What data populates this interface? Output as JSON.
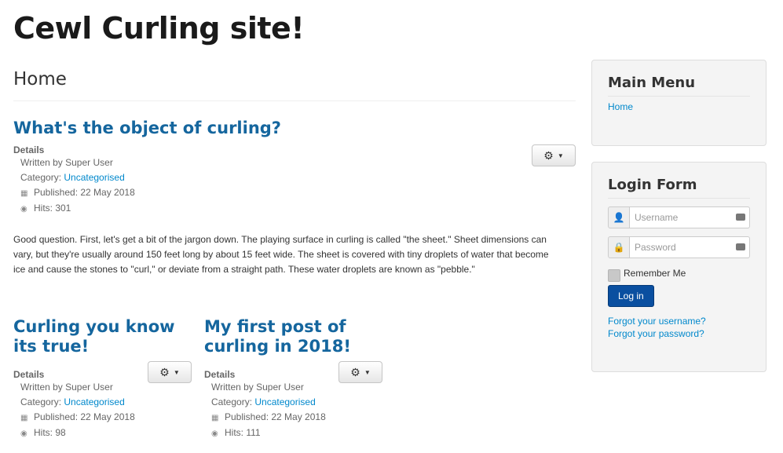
{
  "site_title": "Cewl Curling site!",
  "page_heading": "Home",
  "lead_article": {
    "title": "What's the object of curling?",
    "details_label": "Details",
    "author": "Written by Super User",
    "category_label": "Category: ",
    "category": "Uncategorised",
    "published": "Published: 22 May 2018",
    "hits": "Hits: 301",
    "body": "Good question. First, let's get a bit of the jargon down. The playing surface in curling is called \"the sheet.\" Sheet dimensions can vary, but they're usually around 150 feet long by about 15 feet wide. The sheet is covered with tiny droplets of water that become ice and cause the stones to \"curl,\" or deviate from a straight path. These water droplets are known as \"pebble.\""
  },
  "articles": [
    {
      "title": "Curling you know its true!",
      "details_label": "Details",
      "author": "Written by Super User",
      "category_label": "Category: ",
      "category": "Uncategorised",
      "published": "Published: 22 May 2018",
      "hits": "Hits: 98"
    },
    {
      "title": "My first post of curling in 2018!",
      "details_label": "Details",
      "author": "Written by Super User",
      "category_label": "Category: ",
      "category": "Uncategorised",
      "published": "Published: 22 May 2018",
      "hits": "Hits: 111"
    }
  ],
  "main_menu": {
    "title": "Main Menu",
    "items": [
      "Home"
    ]
  },
  "login_form": {
    "title": "Login Form",
    "username_placeholder": "Username",
    "password_placeholder": "Password",
    "remember_label": "Remember Me",
    "login_button": "Log in",
    "forgot_username": "Forgot your username?",
    "forgot_password": "Forgot your password?"
  },
  "icons": {
    "gear": "gear-icon",
    "caret": "caret-down-icon",
    "calendar": "calendar-icon",
    "eye": "eye-icon",
    "user": "user-icon",
    "lock": "lock-icon",
    "keyboard": "keyboard-icon"
  },
  "colors": {
    "link": "#0088cc",
    "title": "#15669e",
    "login_button": "#0a4fa0"
  }
}
